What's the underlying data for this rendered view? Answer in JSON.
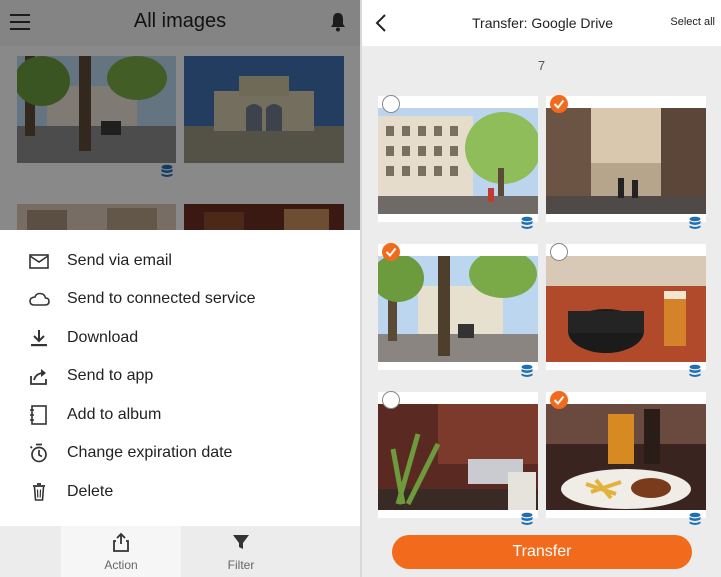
{
  "left_screen": {
    "app_bar": {
      "title": "All images",
      "menu_icon": "hamburger-icon",
      "notification_icon": "bell-icon"
    },
    "action_sheet": {
      "items": [
        {
          "label": "Send via email",
          "icon": "envelope-icon"
        },
        {
          "label": "Send to connected service",
          "icon": "cloud-icon"
        },
        {
          "label": "Download",
          "icon": "download-icon"
        },
        {
          "label": "Send to app",
          "icon": "share-icon"
        },
        {
          "label": "Add to album",
          "icon": "album-icon"
        },
        {
          "label": "Change expiration date",
          "icon": "timer-icon"
        },
        {
          "label": "Delete",
          "icon": "trash-icon"
        }
      ]
    },
    "bottom_nav": {
      "action": {
        "label": "Action",
        "icon": "upload-share-icon"
      },
      "filter": {
        "label": "Filter",
        "icon": "funnel-icon"
      }
    }
  },
  "right_screen": {
    "app_bar": {
      "back_icon": "back-chevron-icon",
      "title": "Transfer: Google Drive",
      "select_all": "Select all"
    },
    "selected_count": "7",
    "photos": [
      {
        "checked": false
      },
      {
        "checked": true
      },
      {
        "checked": true
      },
      {
        "checked": false
      },
      {
        "checked": false
      },
      {
        "checked": true
      }
    ],
    "transfer_button": "Transfer"
  },
  "colors": {
    "accent": "#f26a1b",
    "cloud_badge": "#1f6fb5",
    "scrim": "rgba(0,0,0,0.45)"
  }
}
